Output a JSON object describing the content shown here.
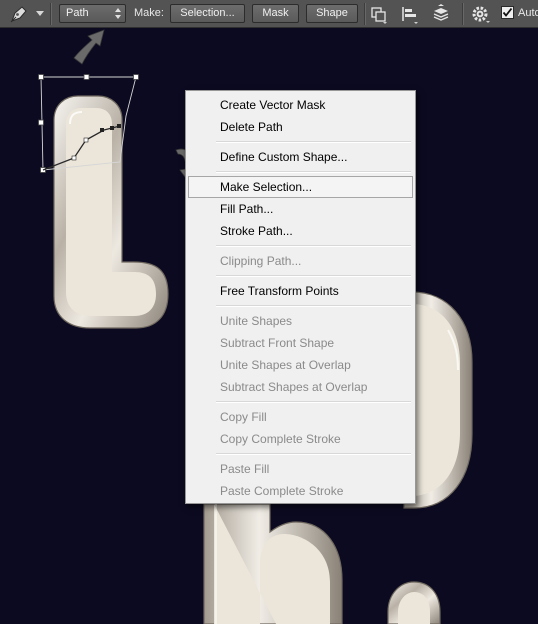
{
  "toolbar": {
    "tool_icon": "pen-tool-icon",
    "mode_value": "Path",
    "make_label": "Make:",
    "selection_label": "Selection...",
    "mask_label": "Mask",
    "shape_label": "Shape",
    "path_operations_icon": "path-operations-icon",
    "path_alignment_icon": "path-alignment-icon",
    "path_arrangement_icon": "path-arrangement-icon",
    "settings_icon": "gear-icon",
    "auto_add_delete_checked": true,
    "auto_add_delete_label": "Auto"
  },
  "menu": {
    "items": [
      {
        "label": "Create Vector Mask",
        "enabled": true
      },
      {
        "label": "Delete Path",
        "enabled": true
      },
      {
        "label": "Define Custom Shape...",
        "enabled": true
      },
      {
        "label": "Make Selection...",
        "enabled": true,
        "highlighted": true
      },
      {
        "label": "Fill Path...",
        "enabled": true
      },
      {
        "label": "Stroke Path...",
        "enabled": true
      },
      {
        "label": "Clipping Path...",
        "enabled": false
      },
      {
        "label": "Free Transform Points",
        "enabled": true
      },
      {
        "label": "Unite Shapes",
        "enabled": false
      },
      {
        "label": "Subtract Front Shape",
        "enabled": false
      },
      {
        "label": "Unite Shapes at Overlap",
        "enabled": false
      },
      {
        "label": "Subtract Shapes at Overlap",
        "enabled": false
      },
      {
        "label": "Copy Fill",
        "enabled": false
      },
      {
        "label": "Copy Complete Stroke",
        "enabled": false
      },
      {
        "label": "Paste Fill",
        "enabled": false
      },
      {
        "label": "Paste Complete Stroke",
        "enabled": false
      }
    ]
  },
  "colors": {
    "canvas_background": "#0b0a20",
    "letter_fill": "#ece6da",
    "toolbar_background": "#535353",
    "menu_background": "#f0f0f0",
    "arrow_annotation": "#6a6a6a"
  }
}
